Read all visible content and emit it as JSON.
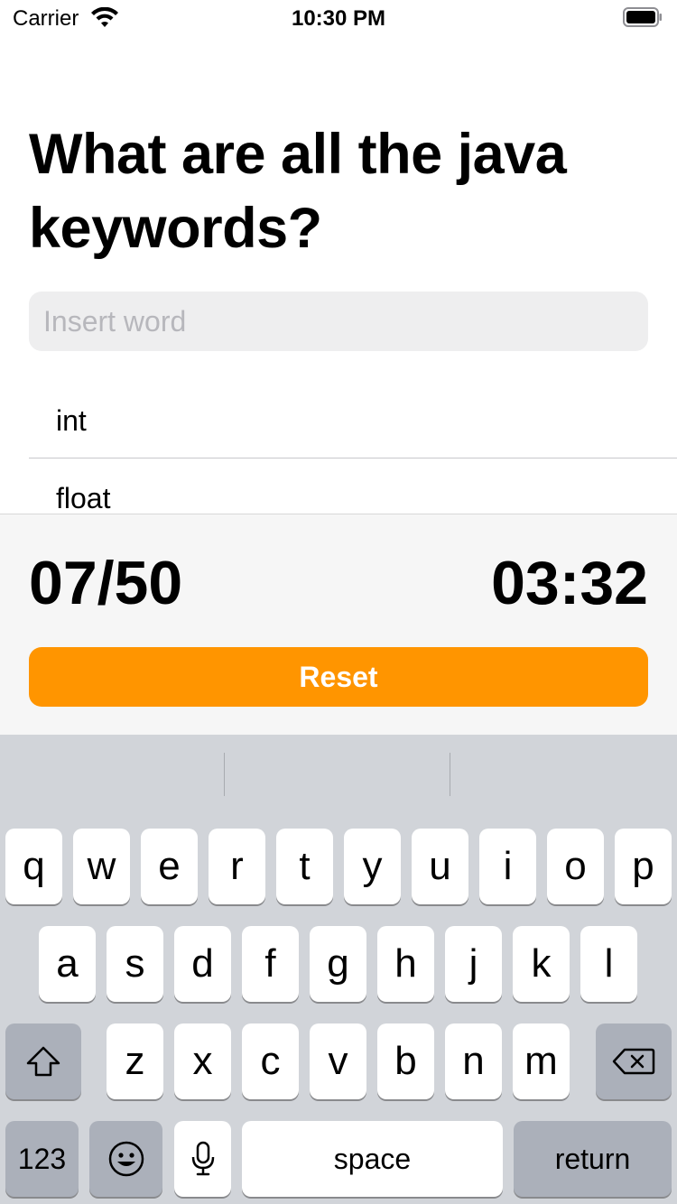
{
  "status_bar": {
    "carrier": "Carrier",
    "time": "10:30 PM"
  },
  "question": {
    "text": "What are all the java keywords?"
  },
  "input": {
    "placeholder": "Insert word",
    "value": ""
  },
  "answers": [
    {
      "word": "int"
    },
    {
      "word": "float"
    }
  ],
  "footer": {
    "score": "07/50",
    "timer": "03:32",
    "reset_label": "Reset"
  },
  "keyboard": {
    "row1": [
      "q",
      "w",
      "e",
      "r",
      "t",
      "y",
      "u",
      "i",
      "o",
      "p"
    ],
    "row2": [
      "a",
      "s",
      "d",
      "f",
      "g",
      "h",
      "j",
      "k",
      "l"
    ],
    "row3": [
      "z",
      "x",
      "c",
      "v",
      "b",
      "n",
      "m"
    ],
    "numbers_label": "123",
    "space_label": "space",
    "return_label": "return"
  },
  "colors": {
    "accent": "#ff9500",
    "keyboard_bg": "#d1d4d9",
    "footer_bg": "#f6f6f6",
    "input_bg": "#eeeeef"
  },
  "icons": {
    "wifi": "wifi-icon",
    "battery": "battery-icon",
    "shift": "shift-icon",
    "delete": "delete-icon",
    "emoji": "emoji-icon",
    "mic": "microphone-icon"
  }
}
